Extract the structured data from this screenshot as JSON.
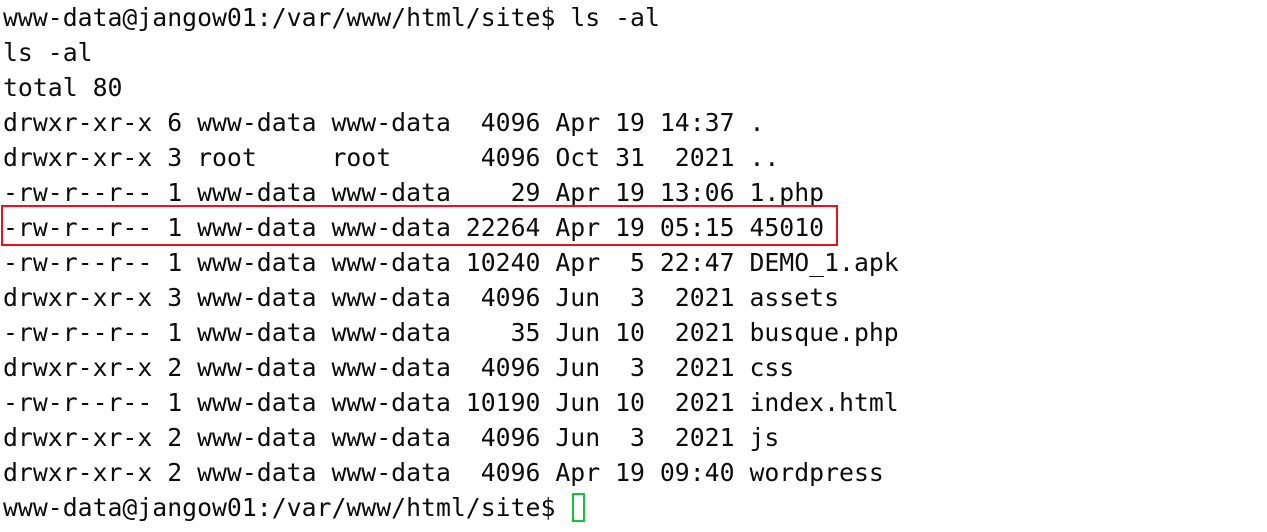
{
  "terminal": {
    "prompt": "www-data@jangow01:/var/www/html/site$",
    "command": "ls -al",
    "echo": "ls -al",
    "total": "total 80",
    "rows": [
      "drwxr-xr-x 6 www-data www-data  4096 Apr 19 14:37 .",
      "drwxr-xr-x 3 root     root      4096 Oct 31  2021 ..",
      "-rw-r--r-- 1 www-data www-data    29 Apr 19 13:06 1.php",
      "-rw-r--r-- 1 www-data www-data 22264 Apr 19 05:15 45010",
      "-rw-r--r-- 1 www-data www-data 10240 Apr  5 22:47 DEMO_1.apk",
      "drwxr-xr-x 3 www-data www-data  4096 Jun  3  2021 assets",
      "-rw-r--r-- 1 www-data www-data    35 Jun 10  2021 busque.php",
      "drwxr-xr-x 2 www-data www-data  4096 Jun  3  2021 css",
      "-rw-r--r-- 1 www-data www-data 10190 Jun 10  2021 index.html",
      "drwxr-xr-x 2 www-data www-data  4096 Jun  3  2021 js",
      "drwxr-xr-x 2 www-data www-data  4096 Apr 19 09:40 wordpress"
    ],
    "highlighted_row": "-rw-r--r-- 1 www-data www-data 22264 Apr 19 05:15 45010",
    "colors": {
      "background": "#ffffff",
      "text": "#0c0c0c",
      "highlight_border": "#e81123",
      "cursor": "#13c13d"
    }
  }
}
